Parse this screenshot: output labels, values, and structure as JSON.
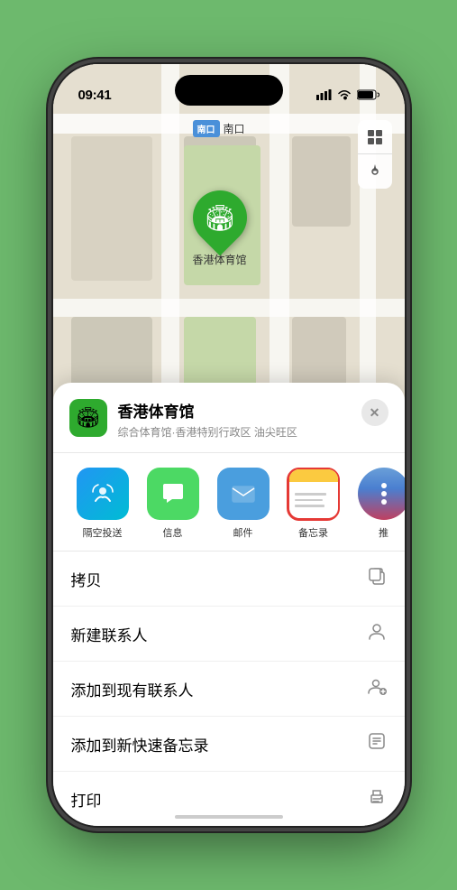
{
  "status_bar": {
    "time": "09:41",
    "location_icon": "▶"
  },
  "map": {
    "label_tag": "南口",
    "label_type": "出口"
  },
  "venue": {
    "name": "香港体育馆",
    "subtitle": "综合体育馆·香港特别行政区 油尖旺区",
    "pin_label": "香港体育馆"
  },
  "share_items": [
    {
      "id": "airdrop",
      "label": "隔空投送",
      "type": "airdrop"
    },
    {
      "id": "messages",
      "label": "信息",
      "type": "messages"
    },
    {
      "id": "mail",
      "label": "邮件",
      "type": "mail"
    },
    {
      "id": "notes",
      "label": "备忘录",
      "type": "notes"
    },
    {
      "id": "more",
      "label": "推",
      "type": "more"
    }
  ],
  "actions": [
    {
      "id": "copy",
      "label": "拷贝",
      "icon": "copy"
    },
    {
      "id": "new-contact",
      "label": "新建联系人",
      "icon": "person"
    },
    {
      "id": "add-existing",
      "label": "添加到现有联系人",
      "icon": "person-add"
    },
    {
      "id": "add-notes",
      "label": "添加到新快速备忘录",
      "icon": "note"
    },
    {
      "id": "print",
      "label": "打印",
      "icon": "print"
    }
  ],
  "close_label": "✕"
}
